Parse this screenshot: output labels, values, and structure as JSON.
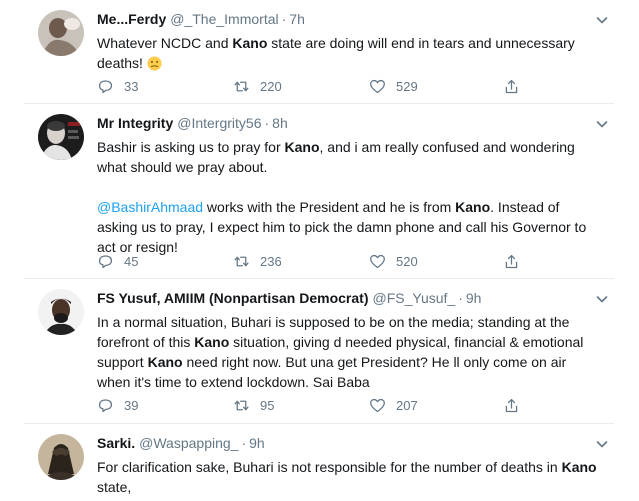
{
  "tweets": [
    {
      "name": "Me...Ferdy",
      "handle": "@_The_Immortal",
      "time": "7h",
      "text_parts": [
        "Whatever NCDC and ",
        "Kano",
        " state are doing will end in tears and unnecessary deaths! "
      ],
      "emoji": "confused-face-icon",
      "replies": "33",
      "retweets": "220",
      "likes": "529"
    },
    {
      "name": "Mr Integrity",
      "handle": "@Intergrity56",
      "time": "8h",
      "p1_parts": [
        "Bashir is asking us to pray for ",
        "Kano",
        ", and i am really confused and wondering what should we pray about."
      ],
      "p2_parts": [
        "@BashirAhmaad",
        " works with the President and he is from ",
        "Kano",
        ". Instead of asking us to pray, I expect him to pick the damn phone and call his Governor to act or resign!"
      ],
      "replies": "45",
      "retweets": "236",
      "likes": "520"
    },
    {
      "name": "FS Yusuf, AMIIM (Nonpartisan Democrat)",
      "handle": "@FS_Yusuf_",
      "time": "9h",
      "text_parts": [
        "In a normal situation, Buhari is supposed to be on the media; standing at the forefront of this ",
        "Kano",
        " situation, giving d needed physical, financial & emotional support ",
        "Kano",
        " need right now. But una get President? He ll only come on air when it's time to extend lockdown. Sai Baba"
      ],
      "replies": "39",
      "retweets": "95",
      "likes": "207"
    },
    {
      "name": "Sarki.",
      "handle": "@Waspapping_",
      "time": "9h",
      "text_parts": [
        "For clarification sake, Buhari is not responsible for the number of deaths in ",
        "Kano",
        " state,"
      ]
    }
  ],
  "colors": {
    "accent": "#1da1f2",
    "muted": "#657786",
    "text": "#14171a",
    "divider": "#e6ecf0"
  }
}
